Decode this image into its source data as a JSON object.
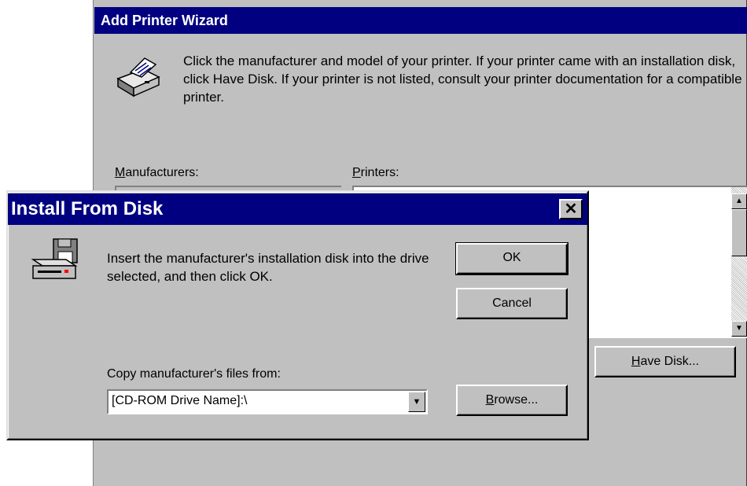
{
  "wizard": {
    "title": "Add Printer Wizard",
    "instructions": "Click the manufacturer and model of your printer. If your printer came with an installation disk, click Have Disk. If your printer is not listed, consult your printer documentation for a compatible printer.",
    "manufacturers_label_mnemonic": "M",
    "manufacturers_label_rest": "anufacturers:",
    "printers_label_mnemonic": "P",
    "printers_label_rest": "rinters:",
    "have_disk_mnemonic": "H",
    "have_disk_rest": "ave Disk..."
  },
  "dialog": {
    "title": "Install From Disk",
    "close_glyph": "✕",
    "message": "Insert the manufacturer's installation disk into the drive selected, and then click OK.",
    "ok_label": "OK",
    "cancel_label": "Cancel",
    "copy_label": "Copy manufacturer's files from:",
    "copy_value": "[CD-ROM Drive Name]:\\",
    "browse_mnemonic": "B",
    "browse_rest": "rowse..."
  },
  "icons": {
    "printer": "printer-icon",
    "disk_drive": "disk-drive-icon",
    "scroll_up": "▲",
    "scroll_down": "▼",
    "dropdown": "▼"
  },
  "colors": {
    "title_bar": "#000080",
    "face": "#c0c0c0"
  }
}
